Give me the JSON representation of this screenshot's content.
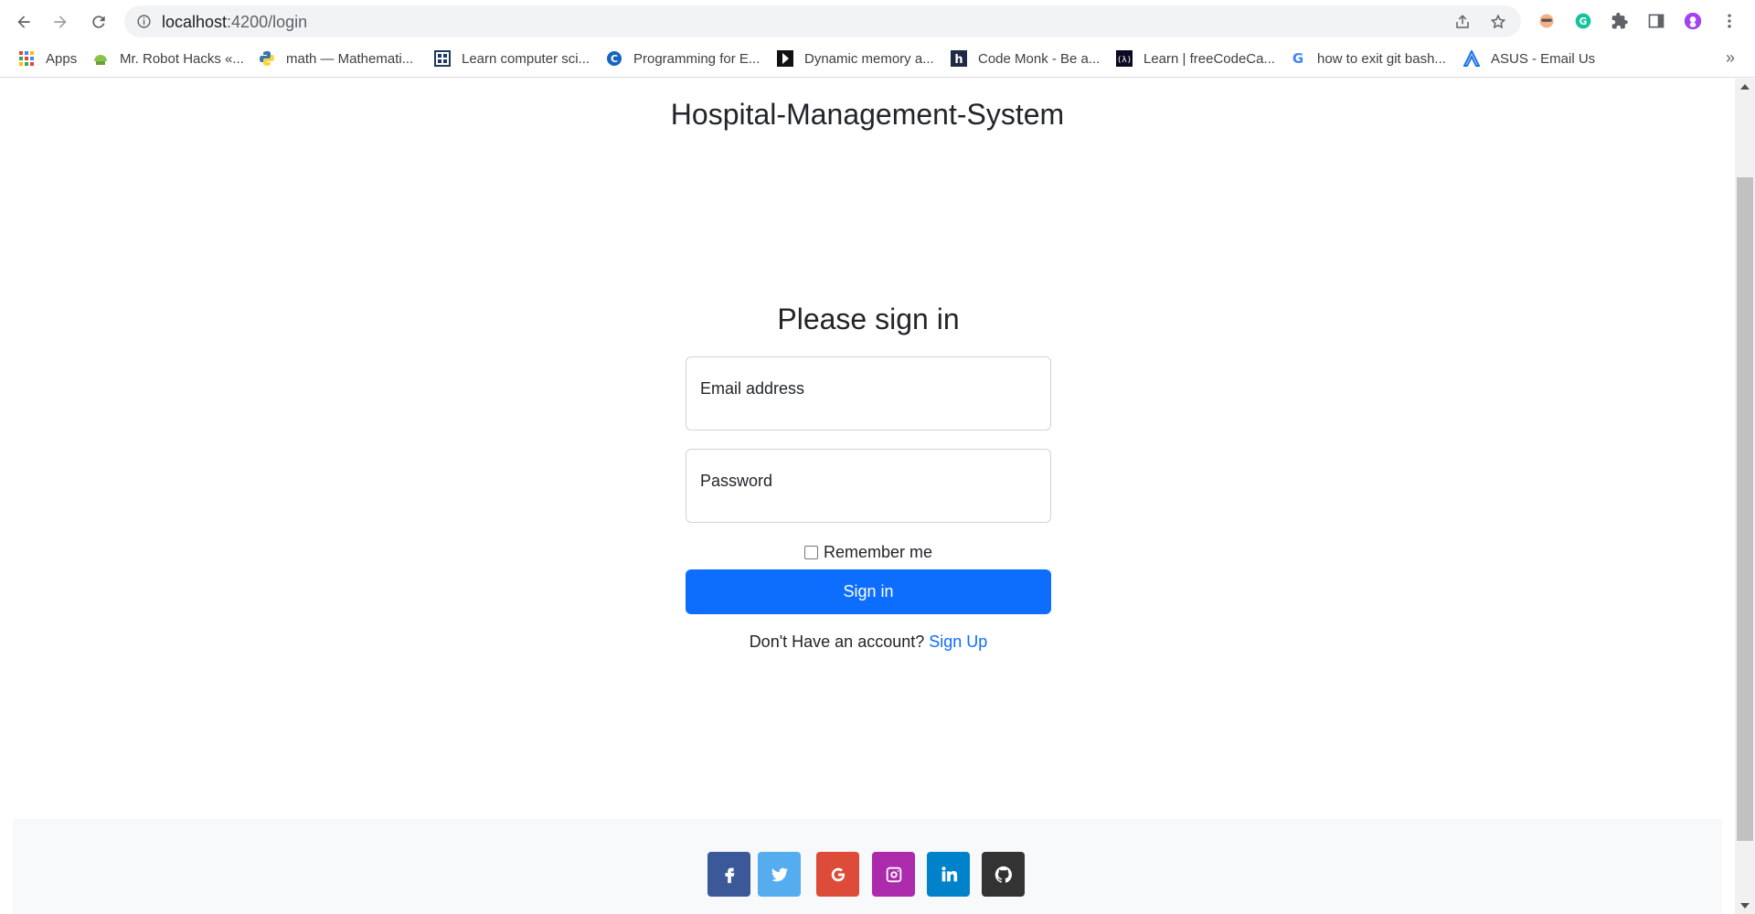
{
  "browser": {
    "url_host": "localhost",
    "url_path": ":4200/login",
    "bookmarks": [
      {
        "label": "Apps",
        "icon": "apps-grid-icon"
      },
      {
        "label": "Mr. Robot Hacks «...",
        "icon": "android-icon"
      },
      {
        "label": "math — Mathemati...",
        "icon": "python-icon"
      },
      {
        "label": "Learn computer sci...",
        "icon": "grid-icon"
      },
      {
        "label": "Programming for E...",
        "icon": "c-icon"
      },
      {
        "label": "Dynamic memory a...",
        "icon": "play-icon"
      },
      {
        "label": "Code Monk - Be a...",
        "icon": "h-icon"
      },
      {
        "label": "Learn | freeCodeCa...",
        "icon": "fcc-icon"
      },
      {
        "label": "how to exit git bash...",
        "icon": "google-icon"
      },
      {
        "label": "ASUS - Email Us",
        "icon": "asus-icon"
      }
    ],
    "more_bookmarks": "»"
  },
  "page": {
    "brand": "Hospital-Management-System",
    "heading": "Please sign in",
    "email_placeholder": "Email address",
    "password_placeholder": "Password",
    "remember_label": "Remember me",
    "submit_label": "Sign in",
    "signup_prompt": "Don't Have an account?",
    "signup_link": "Sign Up"
  },
  "footer": {
    "social": [
      {
        "name": "facebook",
        "color": "#3b5998"
      },
      {
        "name": "twitter",
        "color": "#55acee"
      },
      {
        "name": "google",
        "color": "#dd4b39"
      },
      {
        "name": "instagram",
        "color": "#ac2bac"
      },
      {
        "name": "linkedin",
        "color": "#0082ca"
      },
      {
        "name": "github",
        "color": "#333333"
      }
    ]
  },
  "colors": {
    "primary": "#0d6efd",
    "footer_bg": "#f8f9fa"
  }
}
